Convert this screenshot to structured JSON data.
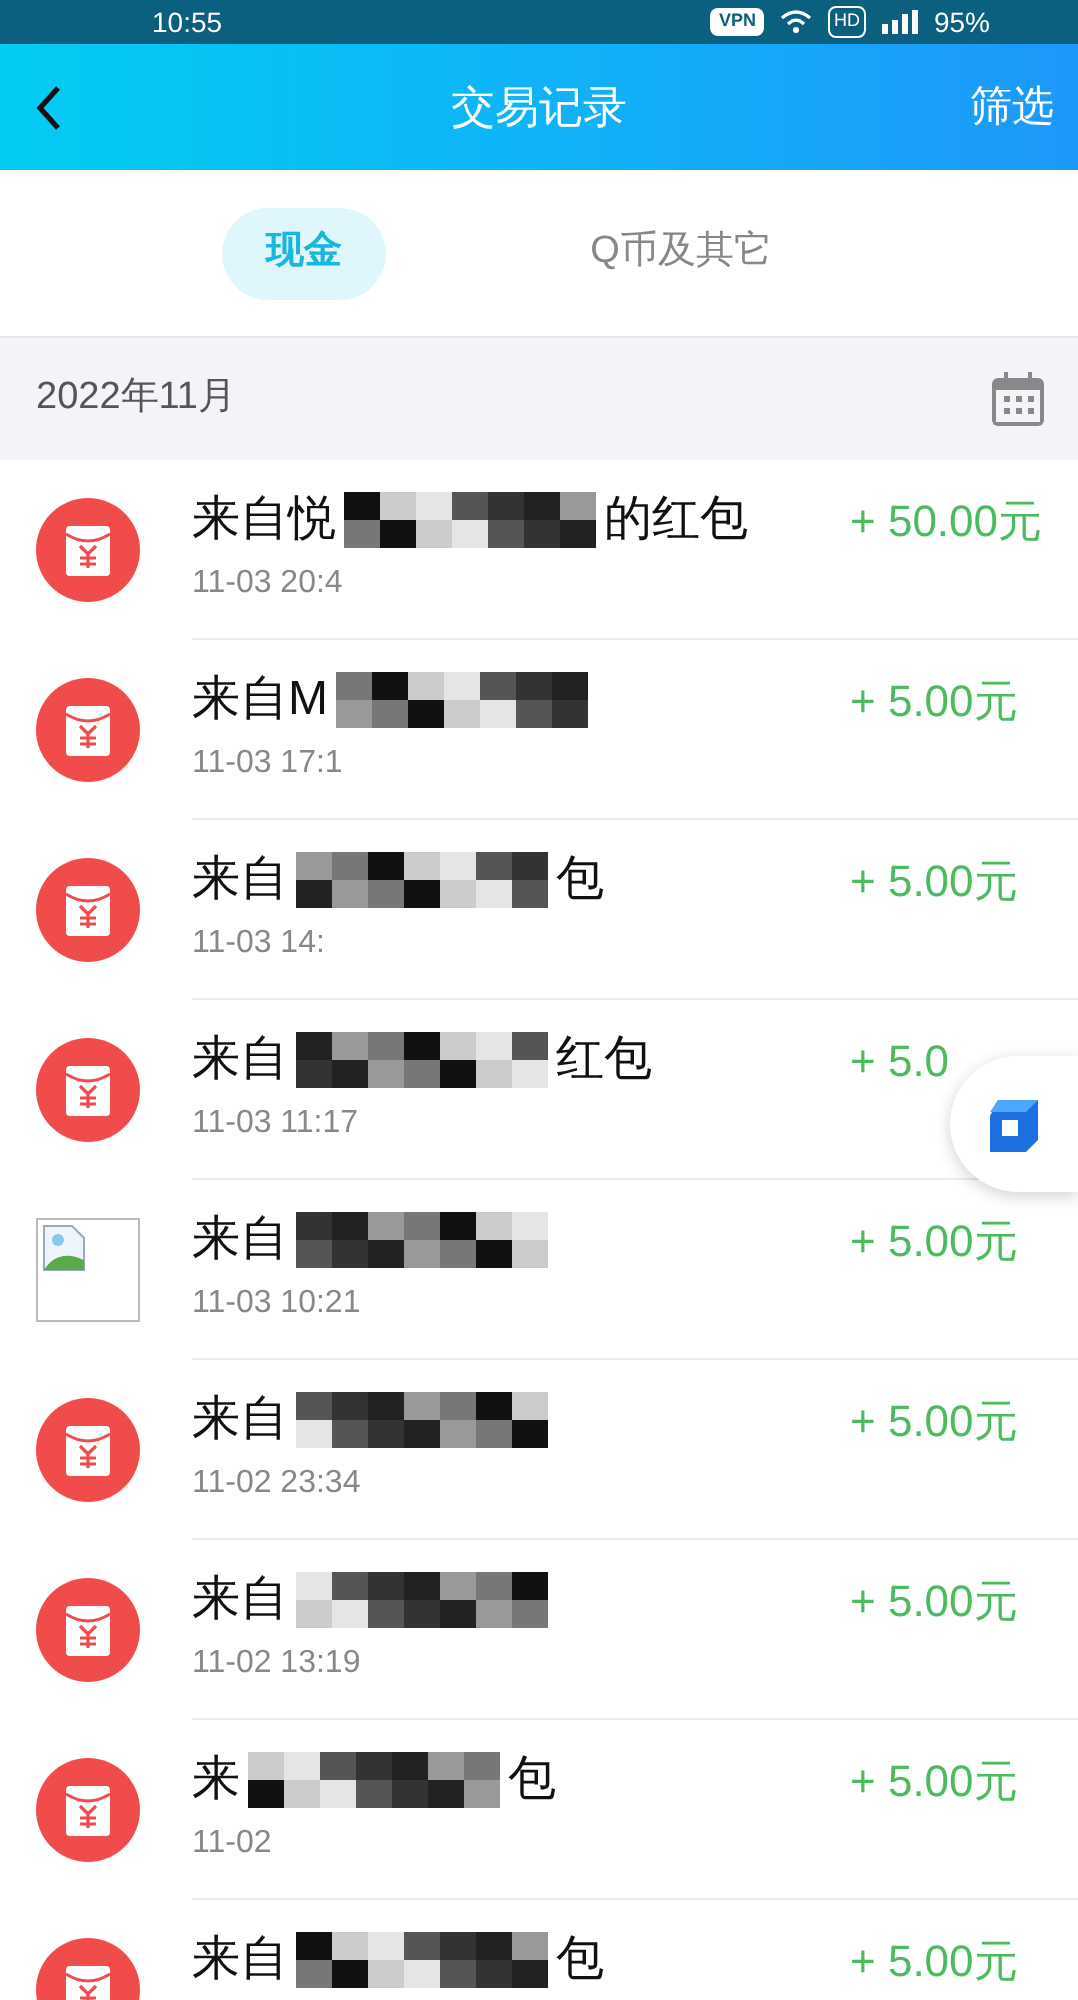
{
  "status_bar": {
    "time": "10:55",
    "vpn": "VPN",
    "hd": "HD",
    "battery": "95%"
  },
  "header": {
    "title": "交易记录",
    "filter": "筛选"
  },
  "tabs": [
    {
      "label": "现金",
      "selected": true
    },
    {
      "label": "Q币及其它",
      "selected": false
    }
  ],
  "month": "2022年11月",
  "transactions": [
    {
      "kind": "packet",
      "prefix": "来自悦",
      "suffix": "的红包",
      "time": "11-03 20:4",
      "amount": "+ 50.00元"
    },
    {
      "kind": "packet",
      "prefix": "来自M",
      "time": "11-03 17:1",
      "amount": "+ 5.00元"
    },
    {
      "kind": "packet",
      "prefix": "来自",
      "suffix": "包",
      "time": "11-03 14:",
      "amount": "+ 5.00元"
    },
    {
      "kind": "packet",
      "prefix": "来自",
      "suffix": "红包",
      "time": "11-03 11:17",
      "amount": "+ 5.0"
    },
    {
      "kind": "image",
      "prefix": "来自",
      "time": "11-03 10:21",
      "amount": "+ 5.00元"
    },
    {
      "kind": "packet",
      "prefix": "来自",
      "time": "11-02 23:34",
      "amount": "+ 5.00元"
    },
    {
      "kind": "packet",
      "prefix": "来自",
      "time": "11-02 13:19",
      "amount": "+ 5.00元"
    },
    {
      "kind": "packet",
      "prefix": "来",
      "suffix": "包",
      "time": "11-02",
      "amount": "+ 5.00元"
    },
    {
      "kind": "packet",
      "prefix": "来自",
      "suffix": "包",
      "amount": "+ 5.00元"
    }
  ]
}
